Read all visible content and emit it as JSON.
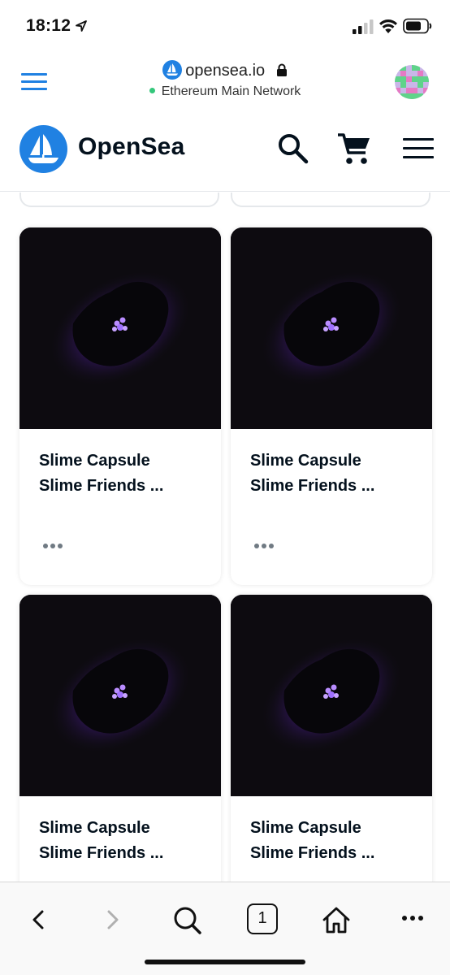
{
  "status_bar": {
    "time": "18:12",
    "icons": [
      "location-arrow-icon",
      "cell-signal-icon",
      "wifi-icon",
      "battery-icon"
    ]
  },
  "browser": {
    "domain": "opensea.io",
    "network": "Ethereum Main Network",
    "network_status_color": "#34c77b",
    "accent": "#2081e2"
  },
  "header": {
    "brand": "OpenSea",
    "brand_color": "#04111d",
    "logo_color": "#2081e2",
    "icons": [
      "search-icon",
      "cart-icon",
      "menu-icon"
    ]
  },
  "grid": {
    "items": [
      {
        "title_line1": "Slime Capsule",
        "title_line2": "Slime Friends ..."
      },
      {
        "title_line1": "Slime Capsule",
        "title_line2": "Slime Friends ..."
      },
      {
        "title_line1": "Slime Capsule",
        "title_line2": "Slime Friends ..."
      },
      {
        "title_line1": "Slime Capsule",
        "title_line2": "Slime Friends ..."
      }
    ]
  },
  "toolbar": {
    "tab_count": "1",
    "icons": [
      "back-icon",
      "forward-icon",
      "search-icon",
      "tabs-icon",
      "home-icon",
      "more-icon"
    ]
  }
}
